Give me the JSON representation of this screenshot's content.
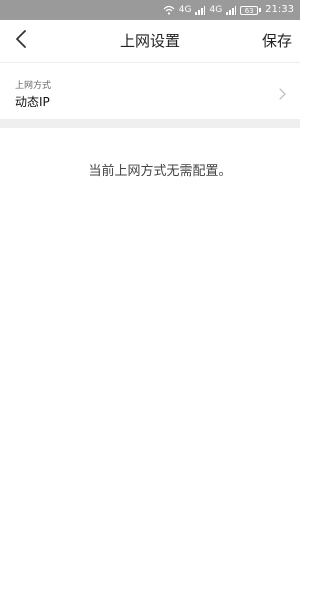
{
  "status_bar": {
    "signal_text_1": "4G",
    "signal_text_2": "4G",
    "battery": "63",
    "time": "21:33",
    "icons": [
      "wifi-icon",
      "signal-icon",
      "signal-icon",
      "battery-icon"
    ]
  },
  "header": {
    "title": "上网设置",
    "save_label": "保存",
    "back_icon": "chevron-left-icon"
  },
  "connection": {
    "label": "上网方式",
    "value": "动态IP",
    "chevron_icon": "chevron-right-icon"
  },
  "message": "当前上网方式无需配置。",
  "colors": {
    "status_bar_bg": "#9a9a9a",
    "separator_bg": "#efefef"
  }
}
